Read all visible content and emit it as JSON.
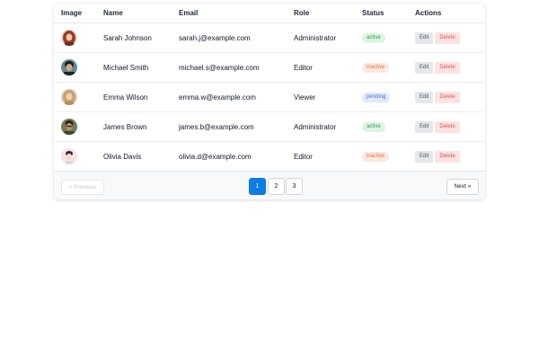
{
  "table": {
    "headers": [
      "Image",
      "Name",
      "Email",
      "Role",
      "Status",
      "Actions"
    ],
    "rows": [
      {
        "avatar": "woman-red-hair-avatar",
        "name": "Sarah Johnson",
        "email": "sarah.j@example.com",
        "role": "Administrator",
        "status": "active",
        "edit": "Edit",
        "delete": "Delete"
      },
      {
        "avatar": "man-dark-hair-avatar",
        "name": "Michael Smith",
        "email": "michael.s@example.com",
        "role": "Editor",
        "status": "inactive",
        "edit": "Edit",
        "delete": "Delete"
      },
      {
        "avatar": "woman-blonde-avatar",
        "name": "Emma Wilson",
        "email": "emma.w@example.com",
        "role": "Viewer",
        "status": "pending",
        "edit": "Edit",
        "delete": "Delete"
      },
      {
        "avatar": "man-glasses-avatar",
        "name": "James Brown",
        "email": "james.b@example.com",
        "role": "Administrator",
        "status": "active",
        "edit": "Edit",
        "delete": "Delete"
      },
      {
        "avatar": "cartoon-avatar",
        "name": "Olivia Davis",
        "email": "olivia.d@example.com",
        "role": "Editor",
        "status": "inactive",
        "edit": "Edit",
        "delete": "Delete"
      }
    ]
  },
  "pagination": {
    "previous": "« Previous",
    "pages": [
      "1",
      "2",
      "3"
    ],
    "active_page": "1",
    "next": "Next »"
  },
  "colors": {
    "active_bg": "#dcf5e3",
    "active_fg": "#2f9e55",
    "inactive_bg": "#fde8dc",
    "inactive_fg": "#e07a45",
    "pending_bg": "#e1e9fb",
    "pending_fg": "#4a72d8",
    "primary": "#0d7be8"
  }
}
